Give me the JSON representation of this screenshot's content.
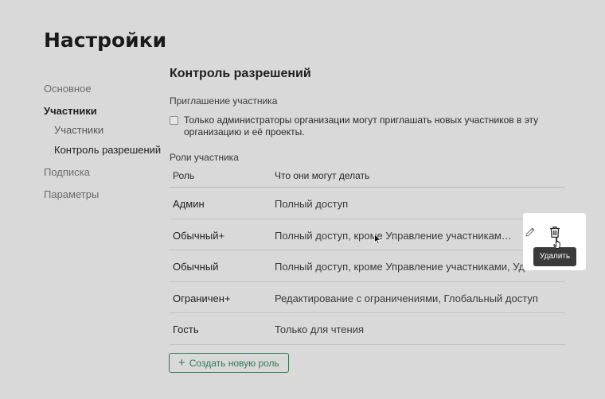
{
  "page": {
    "title": "Настройки"
  },
  "nav": {
    "general": "Основное",
    "members": "Участники",
    "members_sub": "Участники",
    "permissions_sub": "Контроль разрешений",
    "subscription": "Подписка",
    "parameters": "Параметры"
  },
  "main": {
    "section_title": "Контроль разрешений",
    "invite_label": "Приглашение участника",
    "checkbox_text": "Только администраторы организации могут приглашать новых участников в эту организацию и её проекты.",
    "checkbox_checked": false,
    "roles_label": "Роли участника",
    "table": {
      "headers": {
        "role": "Роль",
        "permissions": "Что они могут делать"
      },
      "rows": [
        {
          "role": "Админ",
          "permissions": "Полный доступ"
        },
        {
          "role": "Обычный+",
          "permissions": "Полный доступ, кроме Управление участниками..."
        },
        {
          "role": "Обычный",
          "permissions": "Полный доступ, кроме Управление участниками, Удаление проектов"
        },
        {
          "role": "Ограничен+",
          "permissions": "Редактирование с ограничениями, Глобальный доступ"
        },
        {
          "role": "Гость",
          "permissions": "Только для чтения"
        }
      ]
    },
    "create_button": "Создать новую роль"
  },
  "row_actions": {
    "tooltip": "Удалить",
    "edit_icon": "pencil-icon",
    "delete_icon": "trash-icon"
  },
  "colors": {
    "accent": "#2f7a4f",
    "background": "#d9d9d9",
    "tooltip_bg": "#3a3a3a"
  }
}
